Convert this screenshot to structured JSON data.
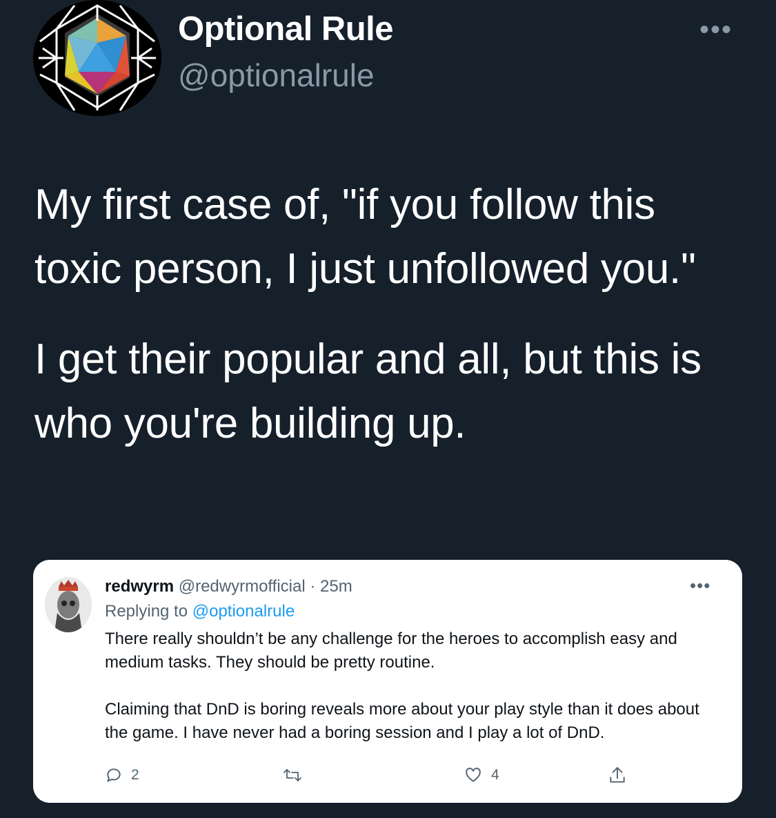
{
  "tweet": {
    "display_name": "Optional Rule",
    "handle": "@optionalrule",
    "more_icon": "more-horizontal-icon",
    "paragraphs": [
      "My first case of, \"if you follow this toxic person, I just unfollowed you.\"",
      "I get their popular and all, but this is who you're building up."
    ]
  },
  "quoted_tweet": {
    "name": "redwyrm",
    "handle": "@redwyrmofficial",
    "separator": "·",
    "time": "25m",
    "replying_prefix": "Replying to",
    "replying_to": "@optionalrule",
    "paragraphs": [
      "There really shouldn’t be any challenge for the heroes to accomplish easy and medium tasks. They should be pretty routine.",
      "Claiming that DnD is boring reveals more about your play style than it does about the game. I have never had a boring session and I play a lot of DnD."
    ],
    "actions": {
      "reply_count": "2",
      "retweet_count": "",
      "like_count": "4"
    }
  },
  "colors": {
    "background": "#15202b",
    "secondary_text": "#8b98a5",
    "link": "#1d9bf0"
  }
}
